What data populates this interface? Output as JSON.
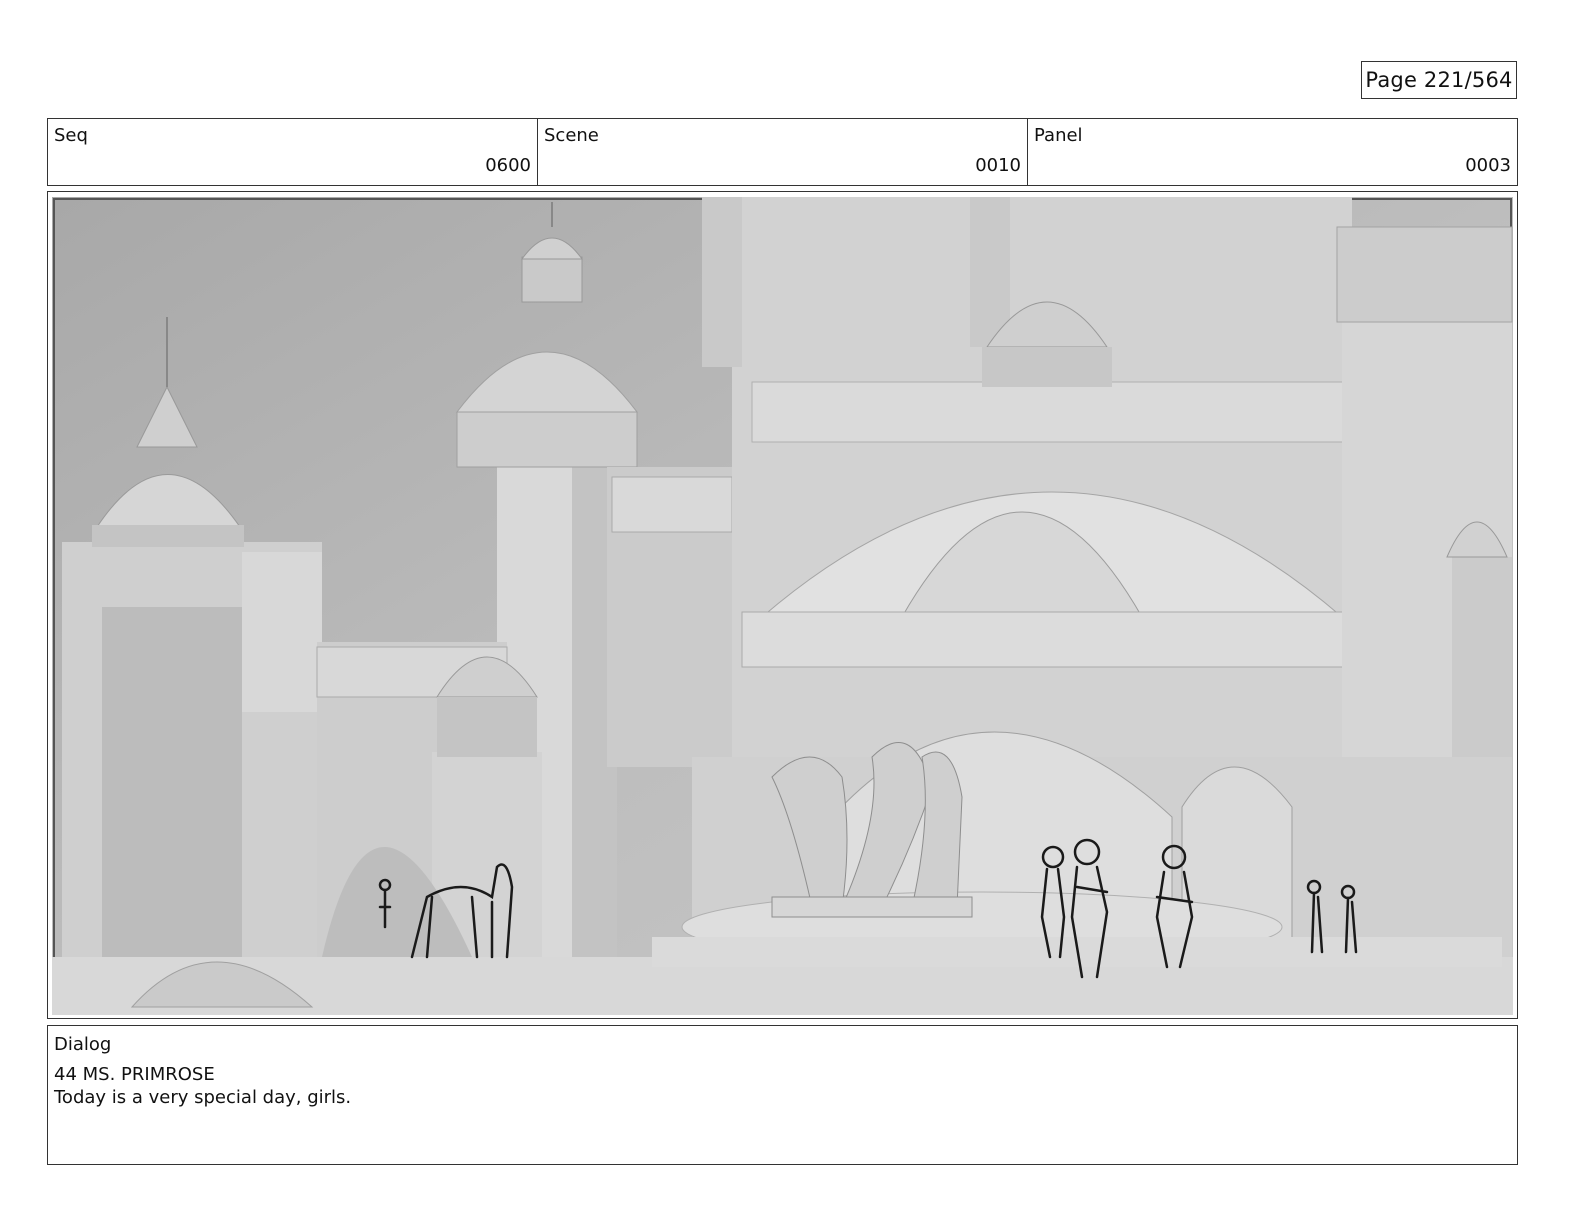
{
  "page": {
    "label": "Page 221/564"
  },
  "header": {
    "seq": {
      "label": "Seq",
      "value": "0600"
    },
    "scene": {
      "label": "Scene",
      "value": "0010"
    },
    "panel": {
      "label": "Panel",
      "value": "0003"
    }
  },
  "dialog": {
    "label": "Dialog",
    "speaker": "44 MS. PRIMROSE",
    "line": "Today is a very special day, girls."
  },
  "colors": {
    "border": "#333333",
    "sky": "#b9b9b9",
    "building_light": "#dcdcdc",
    "building_mid": "#c8c8c8",
    "building_dark": "#a9a9a9",
    "sketch_line": "#1a1a1a"
  }
}
